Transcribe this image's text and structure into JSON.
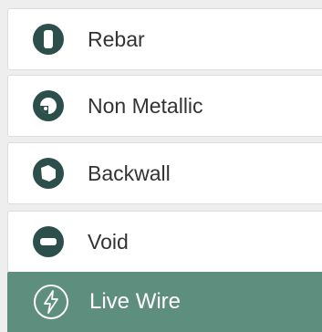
{
  "colors": {
    "icon": "#2c4f4c",
    "selected_bg": "#5e8f7e",
    "selected_text": "#ffffff",
    "text": "#333333"
  },
  "items": [
    {
      "label": "Rebar",
      "icon": "rebar-icon"
    },
    {
      "label": "Non Metallic",
      "icon": "non-metallic-icon"
    },
    {
      "label": "Backwall",
      "icon": "backwall-icon"
    },
    {
      "label": "Void",
      "icon": "void-icon"
    },
    {
      "label": "Live Wire",
      "icon": "lightning-icon",
      "selected": true
    }
  ]
}
